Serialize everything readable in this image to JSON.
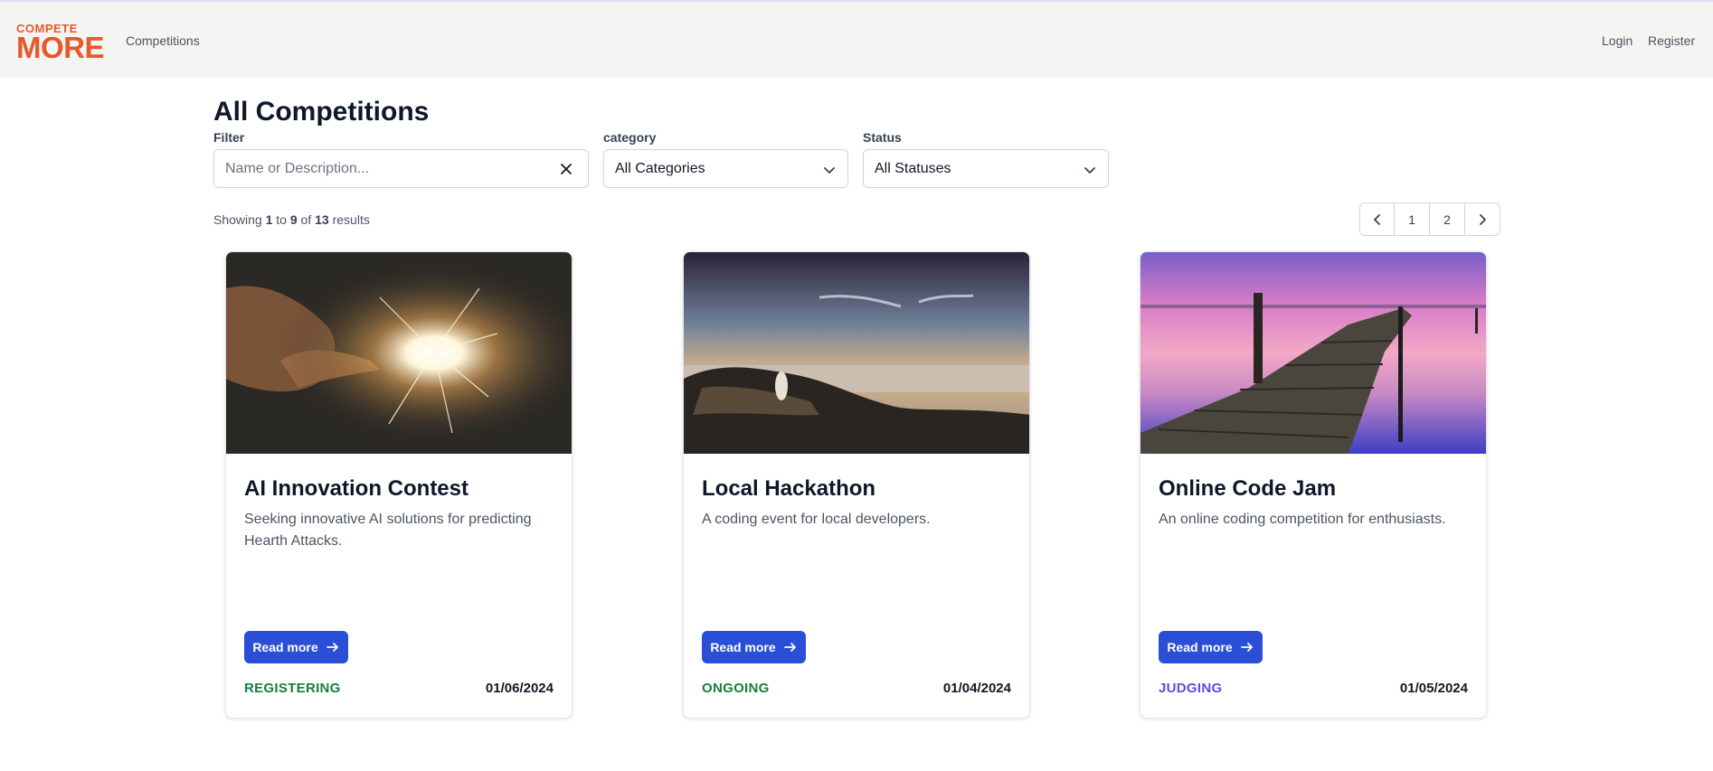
{
  "nav": {
    "logo_top": "COMPETE",
    "logo_main": "MORE",
    "competitions": "Competitions",
    "login": "Login",
    "register": "Register"
  },
  "page": {
    "title": "All Competitions"
  },
  "filters": {
    "filter_label": "Filter",
    "filter_placeholder": "Name or Description...",
    "filter_value": "",
    "category_label": "category",
    "category_selected": "All Categories",
    "status_label": "Status",
    "status_selected": "All Statuses"
  },
  "results": {
    "prefix": "Showing",
    "from": "1",
    "to_word": "to",
    "to": "9",
    "of_word": "of",
    "total": "13",
    "suffix": "results"
  },
  "pagination": {
    "pages": [
      "1",
      "2"
    ],
    "prev_icon": "chevron-left-icon",
    "next_icon": "chevron-right-icon"
  },
  "cards": [
    {
      "title": "AI Innovation Contest",
      "description": "Seeking innovative AI solutions for predicting Hearth Attacks.",
      "button": "Read more",
      "status": "REGISTERING",
      "status_color": "#15803d",
      "date": "01/06/2024"
    },
    {
      "title": "Local Hackathon",
      "description": "A coding event for local developers.",
      "button": "Read more",
      "status": "ONGOING",
      "status_color": "#15803d",
      "date": "01/04/2024"
    },
    {
      "title": "Online Code Jam",
      "description": "An online coding competition for enthusiasts.",
      "button": "Read more",
      "status": "JUDGING",
      "status_color": "#5b4fe0",
      "date": "01/05/2024"
    }
  ],
  "colors": {
    "brand": "#e8582a",
    "primary_button": "#2a4fd6",
    "navbar_bg": "#f4f4f3"
  }
}
